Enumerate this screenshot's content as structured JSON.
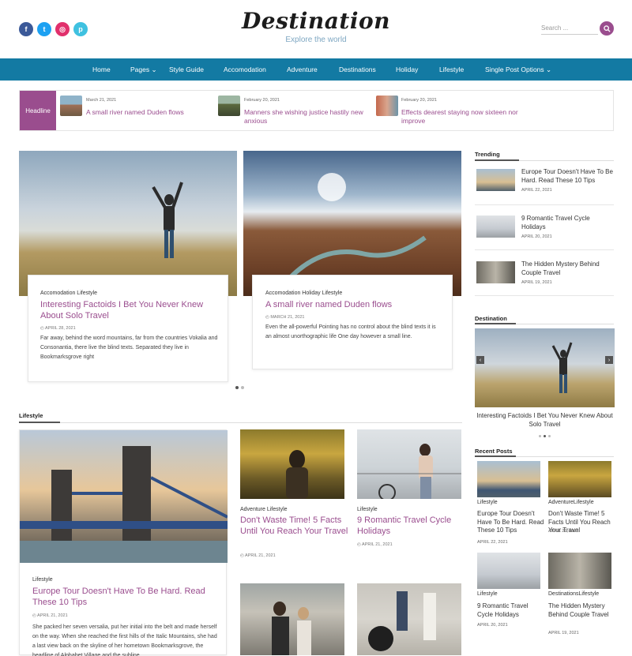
{
  "header": {
    "logo": "Destination",
    "tagline": "Explore the world",
    "search_placeholder": "Search ...",
    "social": [
      {
        "icon": "facebook-icon",
        "glyph": "f",
        "color": "#3b5998"
      },
      {
        "icon": "twitter-icon",
        "glyph": "t",
        "color": "#1da1f2"
      },
      {
        "icon": "instagram-icon",
        "glyph": "◎",
        "color": "#e1306c"
      },
      {
        "icon": "pinterest-icon",
        "glyph": "p",
        "color": "#3fc1e0"
      }
    ]
  },
  "nav": {
    "items": [
      "Home",
      "Pages ⌄",
      "Style Guide",
      "Accomodation",
      "Adventure",
      "Destinations",
      "Holiday",
      "Lifestyle",
      "Single Post Options ⌄"
    ]
  },
  "headline": {
    "label": "Headline",
    "items": [
      {
        "date": "March 21, 2021",
        "title": "A small river named Duden flows"
      },
      {
        "date": "February 20, 2021",
        "title": "Manners she wishing justice hastily new anxious"
      },
      {
        "date": "February 20, 2021",
        "title": "Effects dearest staying now sixteen nor improve"
      }
    ]
  },
  "featured": [
    {
      "cats": "Accomodation  Lifestyle",
      "title": "Interesting Factoids I Bet You Never Knew About Solo Travel",
      "date": "APRIL 28, 2021",
      "excerpt": "Far away, behind the word mountains, far from the countries Vokalia and Consonantia, there live the blind texts. Separated they live in Bookmarksgrove right"
    },
    {
      "cats": "Accomodation  Holiday  Lifestyle",
      "title": "A small river named Duden flows",
      "date": "MARCH 21, 2021",
      "excerpt": "Even the all-powerful Pointing has no control about the blind texts it is an almost unorthographic life One day however a small line."
    }
  ],
  "lifestyle": {
    "heading": "Lifestyle",
    "main": {
      "cat": "Lifestyle",
      "title": "Europe Tour Doesn't Have To Be Hard. Read These 10 Tips",
      "date": "APRIL 21, 2021",
      "excerpt": "She packed her seven versalia, put her initial into the belt and made herself on the way. When she reached the first hills of the Italic Mountains, she had a last view back on the skyline of her hometown Bookmarksgrove, the headline of Alphabet Village and the subline"
    },
    "small": [
      {
        "cat": "Adventure  Lifestyle",
        "title": "Don't Waste Time! 5 Facts Until You Reach Your Travel",
        "date": "APRIL 21, 2021"
      },
      {
        "cat": "Lifestyle",
        "title": "9 Romantic Travel Cycle Holidays",
        "date": "APRIL 21, 2021"
      }
    ]
  },
  "sidebar": {
    "trending_heading": "Trending",
    "trending": [
      {
        "title": "Europe Tour Doesn't Have To Be Hard. Read These 10 Tips",
        "date": "APRIL 22, 2021"
      },
      {
        "title": "9 Romantic Travel Cycle Holidays",
        "date": "APRIL 20, 2021"
      },
      {
        "title": "The Hidden Mystery Behind Couple Travel",
        "date": "APRIL 19, 2021"
      }
    ],
    "destination_heading": "Destination",
    "destination_caption": "Interesting Factoids I Bet You Never Knew About Solo Travel",
    "recent_heading": "Recent Posts",
    "recent": [
      {
        "cat": "Lifestyle",
        "title": "Europe Tour Doesn't Have To Be Hard. Read These 10 Tips",
        "date": "APRIL 22, 2021"
      },
      {
        "cat": "AdventureLifestyle",
        "title": "Don't Waste Time! 5 Facts Until You Reach Your Travel",
        "date": "APRIL 21, 2021"
      },
      {
        "cat": "Lifestyle",
        "title": "9 Romantic Travel Cycle Holidays",
        "date": "APRIL 20, 2021"
      },
      {
        "cat": "DestinationsLifestyle",
        "title": "The Hidden Mystery Behind Couple Travel",
        "date": "APRIL 19, 2021"
      }
    ]
  },
  "colors": {
    "accent": "#9a4d8e",
    "nav": "#137aa3"
  }
}
